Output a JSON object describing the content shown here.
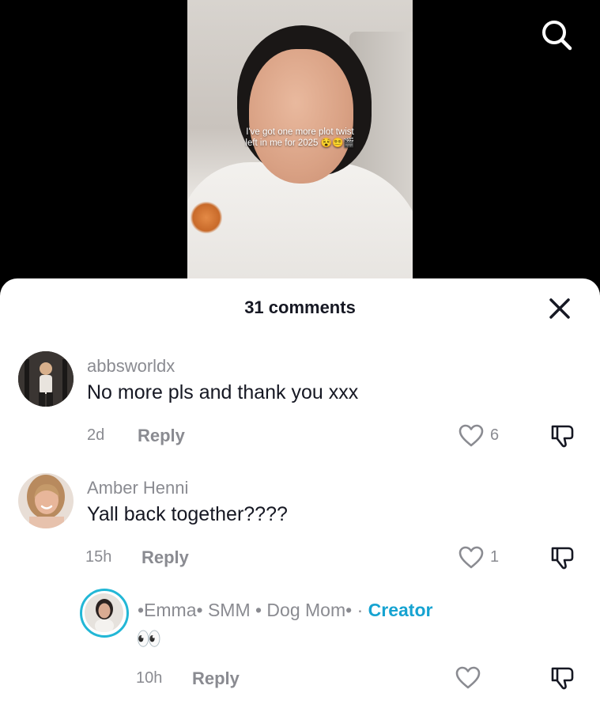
{
  "video": {
    "caption_line1": "I've got one more plot twist",
    "caption_line2": "left in me for 2025 😵😵‍💫🎬"
  },
  "sheet": {
    "title": "31 comments"
  },
  "comments": [
    {
      "username": "abbsworldx",
      "text": "No more pls and thank you xxx",
      "time": "2d",
      "reply_label": "Reply",
      "likes": "6"
    },
    {
      "username": "Amber Henni",
      "text": "Yall back together????",
      "time": "15h",
      "reply_label": "Reply",
      "likes": "1"
    }
  ],
  "reply": {
    "username": "•Emma• SMM • Dog Mom•",
    "separator": " · ",
    "badge": "Creator",
    "text": "👀",
    "time": "10h",
    "reply_label": "Reply"
  },
  "colors": {
    "creator_accent": "#16a3d1",
    "story_ring": "#22b7d6",
    "secondary_text": "#8a8b91"
  }
}
